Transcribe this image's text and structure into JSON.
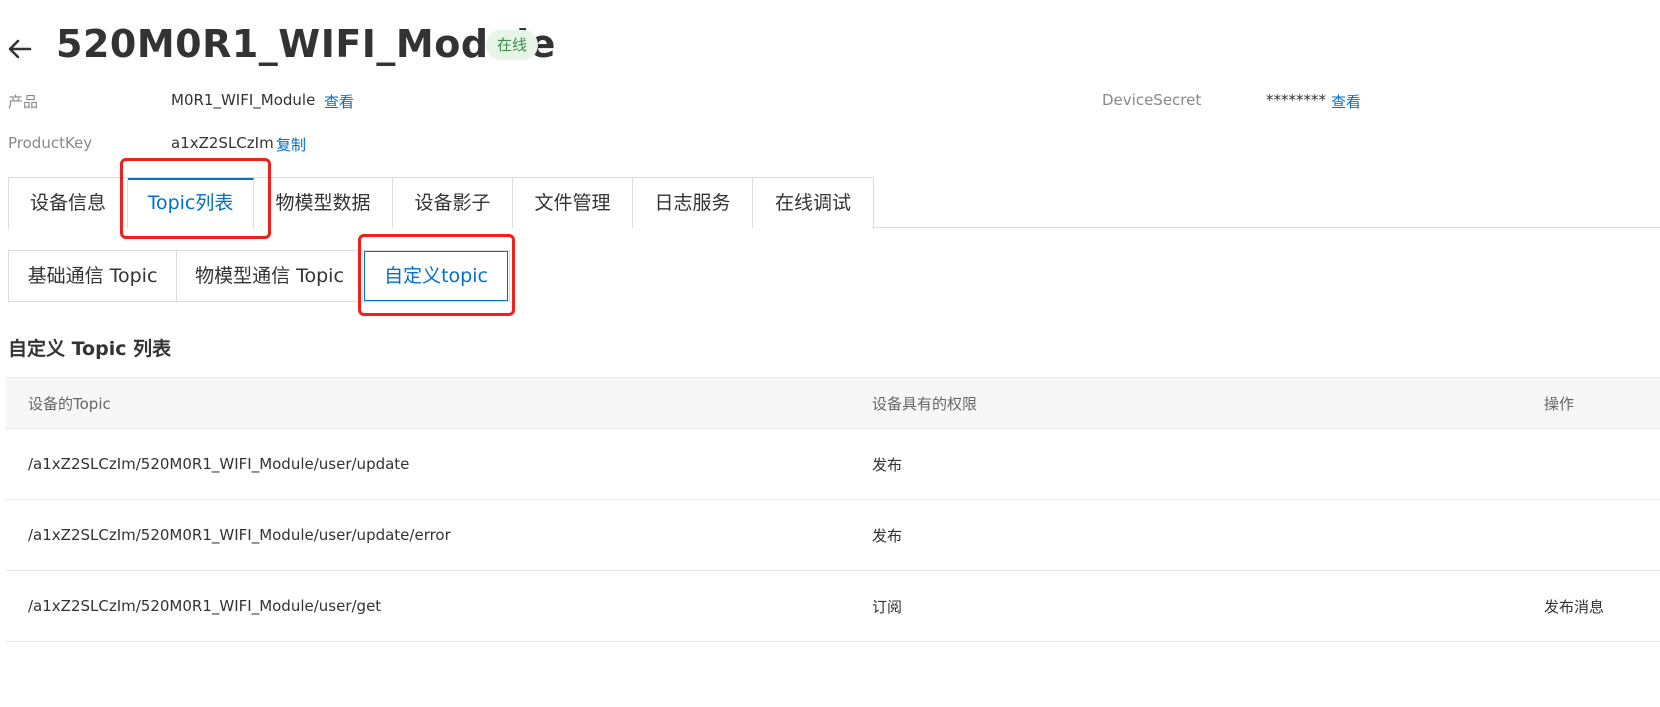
{
  "header": {
    "title": "520M0R1_WIFI_Module",
    "status": "在线",
    "status_color": "#3b8f4a"
  },
  "meta": {
    "product_label": "产品",
    "product_value": "M0R1_WIFI_Module",
    "product_link": "查看",
    "productkey_label": "ProductKey",
    "productkey_value": "a1xZ2SLCzIm",
    "productkey_link": "复制",
    "secret_label": "DeviceSecret",
    "secret_value": "********",
    "secret_link": "查看"
  },
  "main_tabs": [
    {
      "label": "设备信息"
    },
    {
      "label": "Topic列表"
    },
    {
      "label": "物模型数据"
    },
    {
      "label": "设备影子"
    },
    {
      "label": "文件管理"
    },
    {
      "label": "日志服务"
    },
    {
      "label": "在线调试"
    }
  ],
  "active_main_tab": "Topic列表",
  "sub_tabs": [
    {
      "label": "基础通信 Topic"
    },
    {
      "label": "物模型通信 Topic"
    },
    {
      "label": "自定义topic"
    }
  ],
  "active_sub_tab": "自定义topic",
  "section": {
    "title": "自定义 Topic 列表"
  },
  "table": {
    "headers": [
      "设备的Topic",
      "设备具有的权限",
      "操作"
    ],
    "rows": [
      {
        "topic": "/a1xZ2SLCzIm/520M0R1_WIFI_Module/user/update",
        "permission": "发布",
        "action": ""
      },
      {
        "topic": "/a1xZ2SLCzIm/520M0R1_WIFI_Module/user/update/error",
        "permission": "发布",
        "action": ""
      },
      {
        "topic": "/a1xZ2SLCzIm/520M0R1_WIFI_Module/user/get",
        "permission": "订阅",
        "action": "发布消息"
      }
    ]
  },
  "colors": {
    "accent": "#0070cc",
    "highlight": "#f0201a"
  }
}
